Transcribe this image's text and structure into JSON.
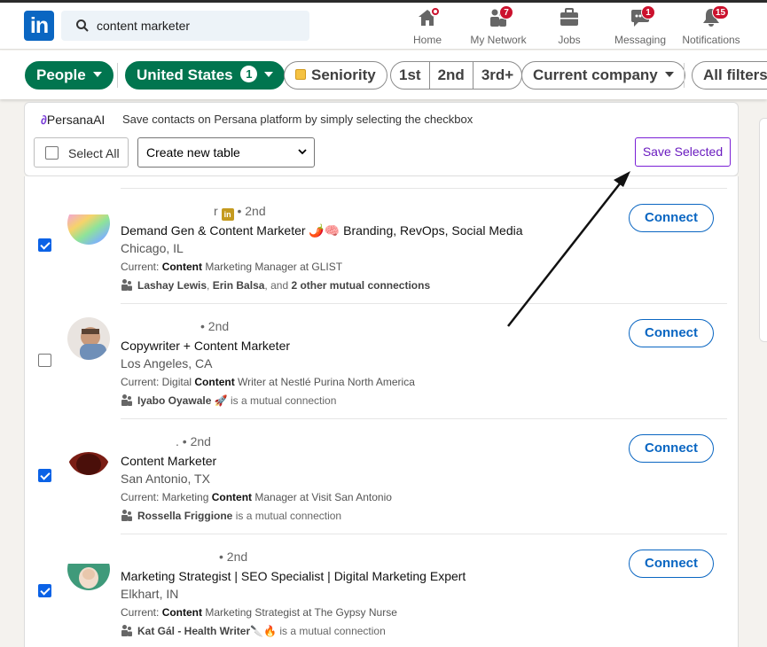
{
  "nav": {
    "search_value": "content marketer",
    "items": [
      {
        "label": "Home",
        "badge": ""
      },
      {
        "label": "My Network",
        "badge": "7"
      },
      {
        "label": "Jobs",
        "badge": ""
      },
      {
        "label": "Messaging",
        "badge": "1"
      },
      {
        "label": "Notifications",
        "badge": "15"
      }
    ]
  },
  "filters": {
    "people": "People",
    "location": "United States",
    "location_count": "1",
    "seniority": "Seniority",
    "degrees": [
      "1st",
      "2nd",
      "3rd+"
    ],
    "company": "Current company",
    "all": "All filters"
  },
  "persana": {
    "brand": "PersanaAI",
    "tagline": "Save contacts on Persana platform by simply selecting the checkbox",
    "select_all": "Select All",
    "table_select": "Create new table",
    "save_button": "Save Selected"
  },
  "results": [
    {
      "checked": true,
      "name_fragment": "r",
      "degree": "• 2nd",
      "headline": "Demand Gen & Content Marketer 🌶️🧠 Branding, RevOps, Social Media",
      "location": "Chicago, IL",
      "current_prefix": "Current: ",
      "current_bold": "Content",
      "current_rest": " Marketing Manager at GLIST",
      "mutual_bold1": "Lashay Lewis",
      "mutual_sep": ", ",
      "mutual_bold2": "Erin Balsa",
      "mutual_mid": ", and ",
      "mutual_bold3": "2 other mutual connections",
      "mutual_rest": "",
      "connect": "Connect"
    },
    {
      "checked": false,
      "name_fragment": "",
      "degree": "• 2nd",
      "headline": "Copywriter + Content Marketer",
      "location": "Los Angeles, CA",
      "current_prefix": "Current: Digital ",
      "current_bold": "Content",
      "current_rest": " Writer at Nestlé Purina North America",
      "mutual_bold1": "Iyabo Oyawale 🚀",
      "mutual_rest": " is a mutual connection",
      "connect": "Connect"
    },
    {
      "checked": true,
      "name_fragment": ".",
      "degree": "• 2nd",
      "headline": "Content Marketer",
      "location": "San Antonio, TX",
      "current_prefix": "Current: Marketing ",
      "current_bold": "Content",
      "current_rest": " Manager at Visit San Antonio",
      "mutual_bold1": "Rossella Friggione",
      "mutual_rest": " is a mutual connection",
      "connect": "Connect"
    },
    {
      "checked": true,
      "name_fragment": "",
      "degree": "• 2nd",
      "headline": "Marketing Strategist | SEO Specialist | Digital Marketing Expert",
      "location": "Elkhart, IN",
      "current_prefix": "Current: ",
      "current_bold": "Content",
      "current_rest": " Marketing Strategist at The Gypsy Nurse",
      "mutual_bold1": "Kat Gál - Health Writer🔪🔥",
      "mutual_rest": " is a mutual connection",
      "connect": "Connect"
    }
  ],
  "colors": {
    "linkedin_blue": "#0a66c2",
    "filter_green": "#01754f",
    "badge_red": "#cb112d",
    "persana_purple": "#7a1fd6",
    "checkbox_blue": "#0b62e6"
  }
}
